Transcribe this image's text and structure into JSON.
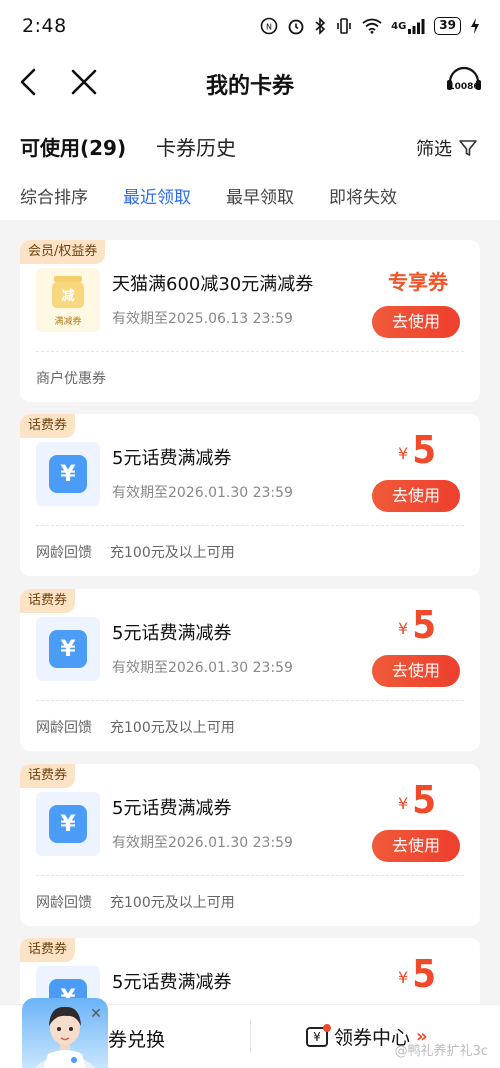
{
  "status": {
    "time": "2:48",
    "network": "4G",
    "battery": "39"
  },
  "nav": {
    "title": "我的卡券",
    "service_label": "10086"
  },
  "tabs": {
    "main": "可使用(29)",
    "history": "卡券历史",
    "filter": "筛选"
  },
  "sort": [
    "综合排序",
    "最近领取",
    "最早领取",
    "即将失效"
  ],
  "sort_active": 1,
  "coupons": [
    {
      "tag": "会员/权益券",
      "title": "天猫满600减30元满减券",
      "expire": "有效期至2025.06.13 23:59",
      "badge": "专享券",
      "button": "去使用",
      "footer": "商户优惠券",
      "thumb_char": "减",
      "thumb_caption": "满减券"
    },
    {
      "tag": "话费券",
      "title": "5元话费满减券",
      "expire": "有效期至2026.01.30 23:59",
      "currency": "¥",
      "amount": "5",
      "button": "去使用",
      "footer_a": "网龄回馈",
      "footer_b": "充100元及以上可用",
      "thumb_char": "¥"
    },
    {
      "tag": "话费券",
      "title": "5元话费满减券",
      "expire": "有效期至2026.01.30 23:59",
      "currency": "¥",
      "amount": "5",
      "button": "去使用",
      "footer_a": "网龄回馈",
      "footer_b": "充100元及以上可用",
      "thumb_char": "¥"
    },
    {
      "tag": "话费券",
      "title": "5元话费满减券",
      "expire": "有效期至2026.01.30 23:59",
      "currency": "¥",
      "amount": "5",
      "button": "去使用",
      "footer_a": "网龄回馈",
      "footer_b": "充100元及以上可用",
      "thumb_char": "¥"
    },
    {
      "tag": "话费券",
      "title": "5元话费满减券",
      "currency": "¥",
      "amount": "5",
      "thumb_char": "¥"
    }
  ],
  "bottom": {
    "left": "券兑换",
    "right": "领券中心",
    "right_icon": "¥",
    "arrows": "»"
  },
  "watermark": "@鸭礼养扩礼3c",
  "colors": {
    "accent": "#2c6cf5",
    "price": "#f04a2a",
    "tag_bg": "#fde3c5",
    "button": "#ee3f2d"
  }
}
